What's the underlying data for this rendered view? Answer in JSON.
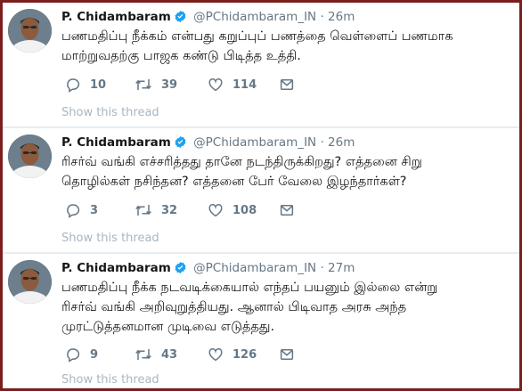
{
  "tweets": [
    {
      "author_name": "P. Chidambaram",
      "handle": "@PChidambaram_IN",
      "separator": "·",
      "time": "26m",
      "text_lines": [
        "பணமதிப்பு நீக்கம் என்பது கறுப்புப் பணத்தை வெள்ளைப் பணமாக",
        "மாற்றுவதற்கு பாஜக கண்டு பிடித்த உத்தி."
      ],
      "replies": "10",
      "retweets": "39",
      "likes": "114",
      "show_thread": "Show this thread"
    },
    {
      "author_name": "P. Chidambaram",
      "handle": "@PChidambaram_IN",
      "separator": "·",
      "time": "26m",
      "text_lines": [
        "ரிசர்வ் வங்கி எச்சரித்தது தானே நடந்திருக்கிறது? எத்தனை சிறு",
        "தொழில்கள் நசிந்தன? எத்தனை பேர் வேலை இழந்தார்கள்?"
      ],
      "replies": "3",
      "retweets": "32",
      "likes": "108",
      "show_thread": "Show this thread"
    },
    {
      "author_name": "P. Chidambaram",
      "handle": "@PChidambaram_IN",
      "separator": "·",
      "time": "27m",
      "text_lines": [
        "பணமதிப்பு நீக்க நடவடிக்கையால் எந்தப் பயனும் இல்லை என்று",
        "ரிசர்வ் வங்கி அறிவுறுத்தியது. ஆனால் பிடிவாத அரசு அந்த",
        "முரட்டுத்தனமான முடிவை எடுத்தது."
      ],
      "replies": "9",
      "retweets": "43",
      "likes": "126",
      "show_thread": "Show this thread"
    }
  ],
  "colors": {
    "frame": "#7a1e1e",
    "name": "#14171a",
    "muted": "#657786",
    "verified": "#1da1f2",
    "show_thread": "#a9b6c0",
    "divider": "#e6ecf0"
  },
  "icons": {
    "avatar": "profile-photo",
    "verified": "verified-badge-icon",
    "reply": "reply-icon",
    "retweet": "retweet-icon",
    "like": "heart-icon",
    "dm": "envelope-icon"
  }
}
